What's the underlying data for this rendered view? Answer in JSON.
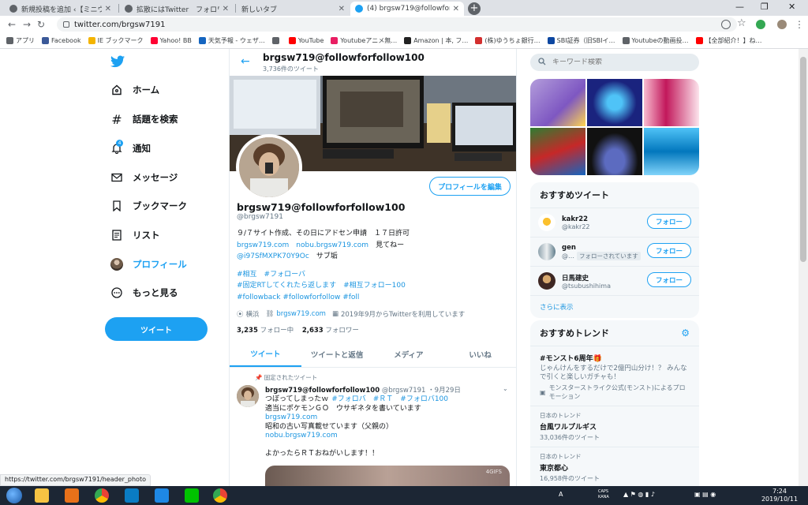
{
  "browser": {
    "tabs": [
      {
        "title": "新規投稿を追加 ‹【ミニウサギ",
        "active": false
      },
      {
        "title": "拡散にはTwitter　フォロワー増",
        "active": false
      },
      {
        "title": "新しいタブ",
        "active": false
      },
      {
        "title": "(4) brgsw719@followforfollo",
        "active": true
      }
    ],
    "new_tab": "+",
    "url": "twitter.com/brgsw7191",
    "bookmarks": [
      {
        "label": "アプリ",
        "color": "#5f6368"
      },
      {
        "label": "Facebook",
        "color": "#3b5998"
      },
      {
        "label": "IE ブックマーク",
        "color": "#f4b400"
      },
      {
        "label": "Yahoo! BB",
        "color": "#ff0033"
      },
      {
        "label": "天気予報 - ウェザ…",
        "color": "#1565c0"
      },
      {
        "label": "",
        "color": "#5f6368"
      },
      {
        "label": "YouTube",
        "color": "#ff0000"
      },
      {
        "label": "Youtubeアニメ無…",
        "color": "#e91e63"
      },
      {
        "label": "Amazon | 本, フ…",
        "color": "#222222"
      },
      {
        "label": "(株)ゆうちょ銀行…",
        "color": "#d32f2f"
      },
      {
        "label": "SBI証券（旧SBIイ…",
        "color": "#0d47a1"
      },
      {
        "label": "Youtubeの動画投…",
        "color": "#5f6368"
      },
      {
        "label": "【全部紹介！】ね…",
        "color": "#ff0000"
      }
    ],
    "status_url": "https://twitter.com/brgsw7191/header_photo"
  },
  "sidebar": {
    "items": [
      {
        "label": "ホーム",
        "icon": "home-icon"
      },
      {
        "label": "話題を検索",
        "icon": "hashtag-icon"
      },
      {
        "label": "通知",
        "icon": "bell-icon"
      },
      {
        "label": "メッセージ",
        "icon": "mail-icon"
      },
      {
        "label": "ブックマーク",
        "icon": "bookmark-icon"
      },
      {
        "label": "リスト",
        "icon": "list-icon"
      },
      {
        "label": "プロフィール",
        "icon": "avatar-icon"
      },
      {
        "label": "もっと見る",
        "icon": "more-icon"
      }
    ],
    "notification_count": "4",
    "tweet_button": "ツイート",
    "brand_color": "#1da1f2"
  },
  "profile": {
    "header_name": "brgsw719@followforfollow100",
    "tweet_count": "3,736件のツイート",
    "edit_button": "プロフィールを編集",
    "name": "brgsw719@followforfollow100",
    "handle": "@brgsw7191",
    "bio": {
      "line1": "９/７サイト作成、その日にアドセン申請　１７日許可",
      "link1": "brgsw719.com",
      "link2": "nobu.brgsw719.com",
      "line2_tail": "見てねー",
      "link3": "@i97SfMXPK70Y9Oc",
      "line3_tail": "サブ垢",
      "tags1": "#相互　#フォローバ",
      "tags2": "#固定RTしてくれたら返します　#相互フォロー100",
      "tags3": "#followback #followforfollow #foll"
    },
    "location": "横浜",
    "website": "brgsw719.com",
    "joined": "2019年9月からTwitterを利用しています",
    "following_count": "3,235",
    "following_label": "フォロー中",
    "followers_count": "2,633",
    "followers_label": "フォロワー",
    "tabs": [
      "ツイート",
      "ツイートと返信",
      "メディア",
      "いいね"
    ]
  },
  "pinned_tweet": {
    "pinned_label": "固定されたツイート",
    "name": "brgsw719@followforfollow100",
    "handle": "@brgsw7191",
    "date": "・9月29日",
    "line1": "つぼってしまったｗ",
    "line1_tags": "#フォロバ　#ＲＴ　#フォロバ100",
    "line2": "適当にポケモンＧＯ　ウサギネタを書いています",
    "link1": "brgsw719.com",
    "line3": "昭和の古い写真載せています（父親の）",
    "link2": "nobu.brgsw719.com",
    "line4": "よかったらＲＴおねがいします！！",
    "media_watermark": "4GIFS"
  },
  "right": {
    "search_placeholder": "キーワード検索",
    "recommended_title": "おすすめツイート",
    "users": [
      {
        "name": "kakr22",
        "handle": "@kakr22",
        "follows_you": ""
      },
      {
        "name": "gen",
        "handle": "@…",
        "follows_you": "フォローされています"
      },
      {
        "name": "日馬建史",
        "handle": "@tsubushihima",
        "follows_you": ""
      }
    ],
    "follow_button": "フォロー",
    "show_more": "さらに表示",
    "trends_title": "おすすめトレンド",
    "trends": [
      {
        "category": "",
        "name": "#モンスト6周年🎁",
        "desc": "じゃんけんをするだけで2億円山分け！？ みんなで引くと楽しいガチャも！",
        "promo": "モンスターストライク公式(モンスト)によるプロモーション",
        "count": ""
      },
      {
        "category": "日本のトレンド",
        "name": "台風ワルプルギス",
        "desc": "",
        "promo": "",
        "count": "33,036件のツイート"
      },
      {
        "category": "日本のトレンド",
        "name": "東京都心",
        "desc": "",
        "promo": "",
        "count": "16,958件のツイート"
      }
    ]
  },
  "taskbar": {
    "time": "7:24",
    "date": "2019/10/11",
    "ime": "A",
    "tray_label": "CAPS KANA"
  }
}
